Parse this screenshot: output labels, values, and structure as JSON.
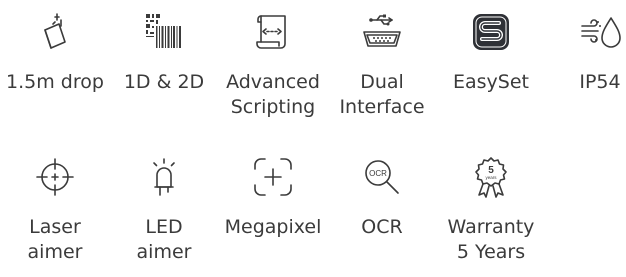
{
  "features_row1": [
    {
      "label": "1.5m drop",
      "icon": "drop-icon"
    },
    {
      "label": "1D & 2D",
      "icon": "barcode-icon"
    },
    {
      "label": "Advanced\nScripting",
      "icon": "script-icon"
    },
    {
      "label": "Dual\nInterface",
      "icon": "usb-serial-icon"
    },
    {
      "label": "EasySet",
      "icon": "easyset-icon"
    },
    {
      "label": "IP54",
      "icon": "ip54-icon"
    }
  ],
  "features_row2": [
    {
      "label": "Laser\naimer",
      "icon": "laser-aimer-icon"
    },
    {
      "label": "LED\naimer",
      "icon": "led-aimer-icon"
    },
    {
      "label": "Megapixel",
      "icon": "megapixel-icon"
    },
    {
      "label": "OCR",
      "icon": "ocr-icon"
    },
    {
      "label": "Warranty\n5 Years",
      "icon": "warranty-icon"
    }
  ],
  "icon_text": {
    "ocr": "OCR",
    "warranty_number": "5",
    "warranty_unit": "years"
  },
  "colors": {
    "text": "#3b3b3b",
    "icon": "#3b3b3b",
    "background": "#ffffff"
  }
}
